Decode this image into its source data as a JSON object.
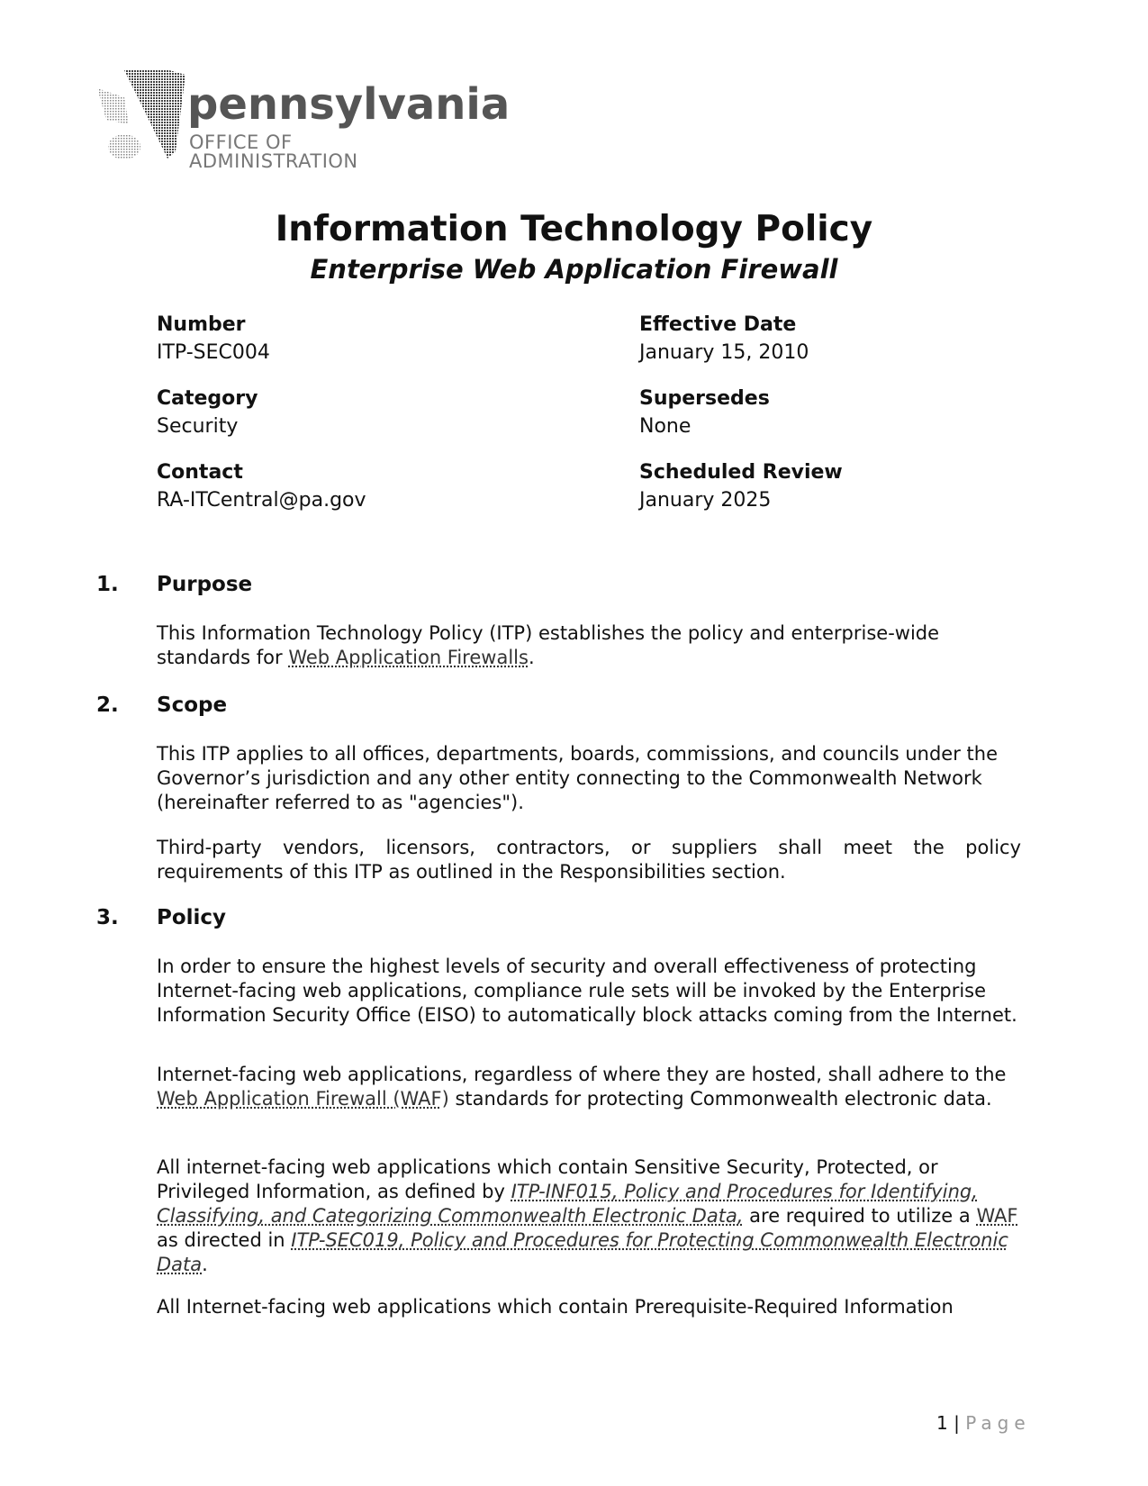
{
  "logo": {
    "name": "pennsylvania",
    "subtitle": "OFFICE OF ADMINISTRATION"
  },
  "header": {
    "title": "Information Technology Policy",
    "subtitle": "Enterprise Web Application Firewall"
  },
  "metadata": {
    "number_label": "Number",
    "number_value": "ITP-SEC004",
    "effective_label": "Effective Date",
    "effective_value": "January 15, 2010",
    "category_label": "Category",
    "category_value": "Security",
    "supersedes_label": "Supersedes",
    "supersedes_value": "None",
    "contact_label": "Contact",
    "contact_value": "RA-ITCentral@pa.gov",
    "review_label": "Scheduled Review",
    "review_value": "January 2025"
  },
  "sections": [
    {
      "num": "1.",
      "title": "Purpose",
      "p1_a": "This Information Technology Policy (ITP) establishes the policy and enterprise-wide standards for ",
      "p1_link": "Web Application Firewalls",
      "p1_b": "."
    },
    {
      "num": "2.",
      "title": "Scope",
      "p1": "This ITP applies to all offices, departments, boards, commissions, and councils under the Governor’s jurisdiction and any other entity connecting to the Commonwealth Network (hereinafter referred to as \"agencies\").",
      "p2_line1": "Third-party vendors, licensors, contractors, or suppliers shall meet the policy",
      "p2_line2": "requirements of this ITP as outlined in the Responsibilities section."
    },
    {
      "num": "3.",
      "title": "Policy",
      "p1": "In order to ensure the highest levels of security and overall effectiveness of protecting Internet-facing web applications, compliance rule sets will be invoked by the Enterprise Information Security Office (EISO) to automatically block attacks coming from the Internet.",
      "p2_a": "Internet-facing web applications, regardless of where they are hosted, shall adhere to the ",
      "p2_link": "Web Application Firewall (WAF)",
      "p2_b": " standards for protecting Commonwealth electronic data.",
      "p3_a": "All internet-facing web applications which contain Sensitive Security, Protected, or Privileged Information, as defined by ",
      "p3_link1": "ITP-INF015, Policy and Procedures for Identifying, Classifying, and Categorizing Commonwealth Electronic Data,",
      "p3_b": " are required to utilize a ",
      "p3_link2": "WAF",
      "p3_c": " as directed in ",
      "p3_link3": "ITP-SEC019, Policy and Procedures for Protecting Commonwealth Electronic Data",
      "p3_d": ".",
      "p4": "All Internet-facing web applications which contain Prerequisite-Required Information"
    }
  ],
  "footer": {
    "page_number": "1",
    "separator": "|",
    "page_label": "Page"
  }
}
